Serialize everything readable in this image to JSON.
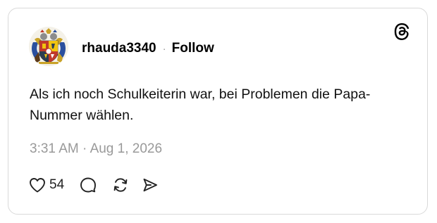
{
  "post": {
    "username": "rhauda3340",
    "separator": "·",
    "follow_label": "Follow",
    "text": "Als ich noch Schulkeiterin war, bei Problemen die Papa-Nummer wählen.",
    "time": "3:31 AM",
    "time_separator": "·",
    "date": "Aug 1, 2026",
    "like_count": "54"
  },
  "icons": {
    "logo": "threads-logo-icon",
    "like": "heart-icon",
    "reply": "comment-icon",
    "repost": "repost-icon",
    "share": "send-icon"
  },
  "colors": {
    "text": "#111111",
    "muted": "#999999",
    "border": "#d9d9d9"
  }
}
